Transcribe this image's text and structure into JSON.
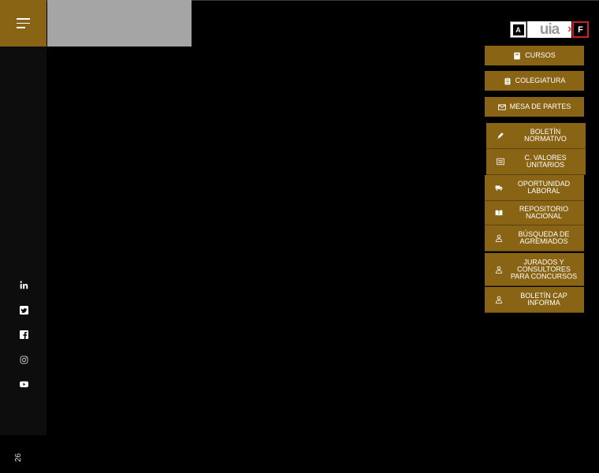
{
  "header": {
    "logos": {
      "logo_a": "A",
      "logo_uia": "uia",
      "logo_uia_arrow": "›",
      "logo_f": "F"
    }
  },
  "sidebar": {
    "social_icons": [
      "linkedin-icon",
      "twitter-icon",
      "facebook-icon",
      "instagram-icon",
      "youtube-icon"
    ],
    "year_fragment": "26"
  },
  "quick_links": [
    {
      "label": "CURSOS",
      "icon": "book-icon"
    },
    {
      "label": "COLEGIATURA",
      "icon": "clipboard-icon"
    },
    {
      "label": "MESA DE PARTES",
      "icon": "envelope-icon"
    }
  ],
  "info_links": [
    {
      "label": "BOLETÍN NORMATIVO",
      "icon": "pen-icon"
    },
    {
      "label": "C. VALORES UNITARIOS",
      "icon": "table-icon"
    },
    {
      "label": "OPORTUNIDAD LABORAL",
      "icon": "truck-icon"
    },
    {
      "label": "REPOSITORIO NACIONAL",
      "icon": "open-book-icon"
    },
    {
      "label": "BÚSQUEDA DE AGREMIADOS",
      "icon": "user-icon"
    },
    {
      "label": "JURADOS Y CONSULTORES PARA CONCURSOS",
      "icon": "user-icon"
    },
    {
      "label": "BOLETÍN CAP INFORMA",
      "icon": "user-icon"
    }
  ],
  "colors": {
    "accent": "#8a6415",
    "background": "#000000",
    "sidebar": "#0d0d0d"
  }
}
